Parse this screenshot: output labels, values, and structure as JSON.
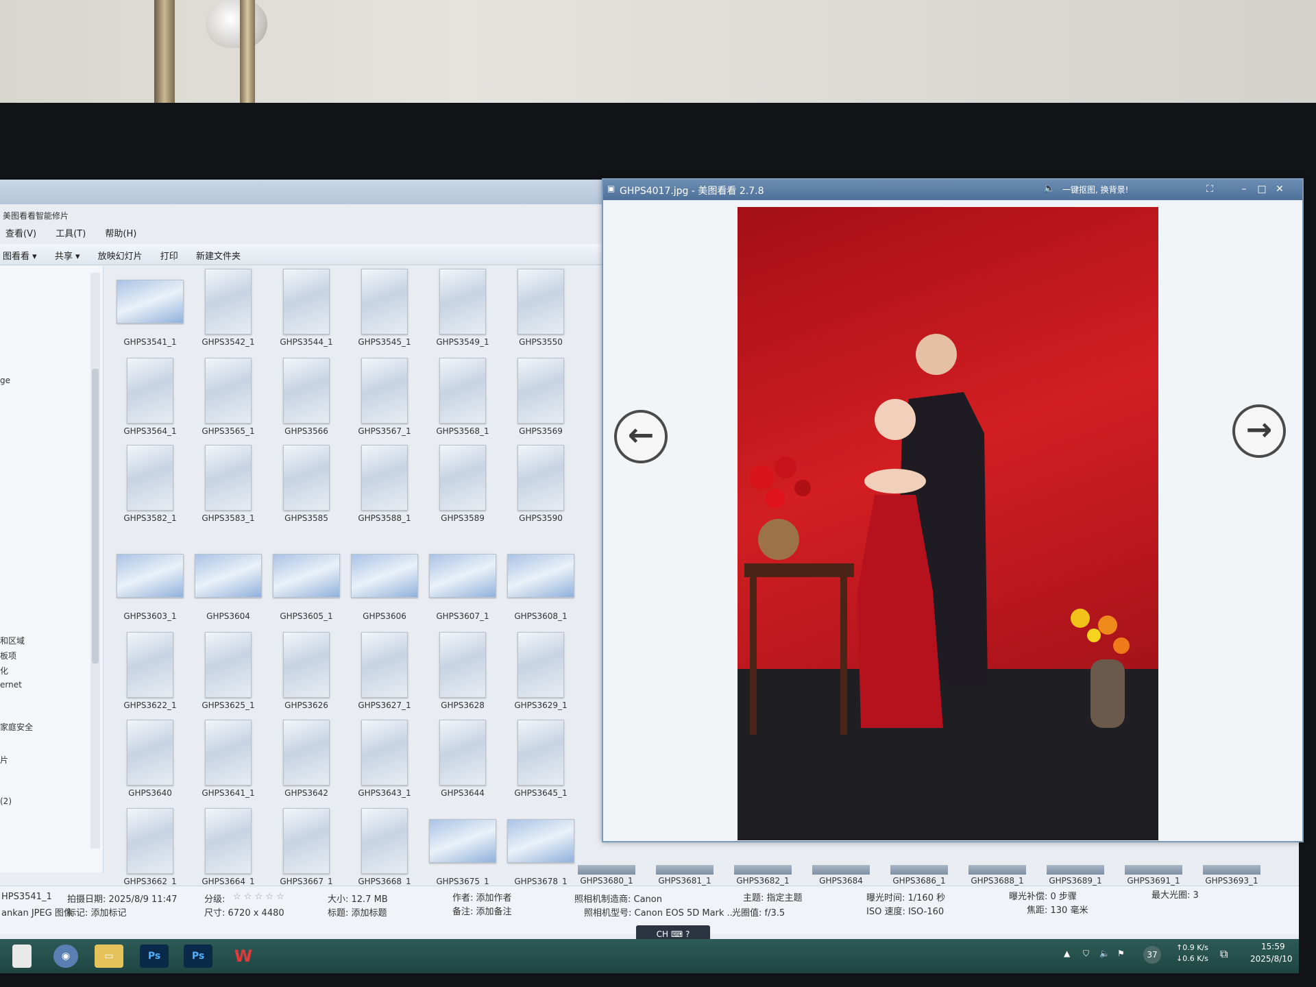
{
  "explorer": {
    "app_title": "美图看看智能修片",
    "menu": [
      "查看(V)",
      "工具(T)",
      "帮助(H)"
    ],
    "toolbar": [
      "图看看 ▾",
      "共享 ▾",
      "放映幻灯片",
      "打印",
      "新建文件夹"
    ],
    "nav_items": [
      "ge",
      "和区域",
      "板项",
      "化",
      "ernet",
      "家庭安全",
      "片",
      "(2)"
    ],
    "thumbnails": [
      [
        "GHPS3541_1",
        "GHPS3542_1",
        "GHPS3544_1",
        "GHPS3545_1",
        "GHPS3549_1",
        "GHPS3550"
      ],
      [
        "GHPS3564_1",
        "GHPS3565_1",
        "GHPS3566",
        "GHPS3567_1",
        "GHPS3568_1",
        "GHPS3569"
      ],
      [
        "GHPS3582_1",
        "GHPS3583_1",
        "GHPS3585",
        "GHPS3588_1",
        "GHPS3589",
        "GHPS3590"
      ],
      [
        "GHPS3603_1",
        "GHPS3604",
        "GHPS3605_1",
        "GHPS3606",
        "GHPS3607_1",
        "GHPS3608_1"
      ],
      [
        "GHPS3622_1",
        "GHPS3625_1",
        "GHPS3626",
        "GHPS3627_1",
        "GHPS3628",
        "GHPS3629_1"
      ],
      [
        "GHPS3640",
        "GHPS3641_1",
        "GHPS3642",
        "GHPS3643_1",
        "GHPS3644",
        "GHPS3645_1"
      ],
      [
        "GHPS3662_1",
        "GHPS3664_1",
        "GHPS3667_1",
        "GHPS3668_1",
        "GHPS3675_1",
        "GHPS3678_1"
      ]
    ],
    "filmstrip": [
      "GHPS3680_1",
      "GHPS3681_1",
      "GHPS3682_1",
      "GHPS3684",
      "GHPS3686_1",
      "GHPS3688_1",
      "GHPS3689_1",
      "GHPS3691_1",
      "GHPS3693_1"
    ]
  },
  "details": {
    "filename": "HPS3541_1",
    "filetype": "ankan JPEG 图像",
    "date_taken": "拍摄日期: 2025/8/9 11:47",
    "tags": "标记: 添加标记",
    "rating_label": "分级:",
    "stars": "☆ ☆ ☆ ☆ ☆",
    "dimensions": "尺寸: 6720 x 4480",
    "size": "大小: 12.7 MB",
    "title": "标题: 添加标题",
    "author": "作者: 添加作者",
    "comments": "备注: 添加备注",
    "camera_maker": "照相机制造商: Canon",
    "camera_model": "照相机型号: Canon EOS 5D Mark ...",
    "subject": "主题: 指定主题",
    "aperture": "光圈值: f/3.5",
    "exposure_time": "曝光时间: 1/160 秒",
    "iso": "ISO 速度: ISO-160",
    "exposure_comp": "曝光补偿: 0 步骤",
    "focal_length": "焦距: 130 毫米",
    "max_aperture": "最大光圈: 3"
  },
  "language_bar": {
    "label": "CH",
    "help": "?"
  },
  "taskbar": {
    "ps1": "Ps",
    "ps2": "Ps",
    "net_up": "↑0.9 K/s",
    "net_down": "↓0.6 K/s",
    "badge": "37",
    "time": "15:59",
    "date": "2025/8/10"
  },
  "viewer": {
    "title": "GHPS4017.jpg - 美图看看 2.7.8",
    "promo": "一键抠图, 换背景!",
    "prev_icon": "arrow-left",
    "next_icon": "arrow-right"
  },
  "colors": {
    "backdrop_red": "#c8161d",
    "taskbar": "#2d5b57",
    "viewer_title": "#5d7fa8"
  }
}
